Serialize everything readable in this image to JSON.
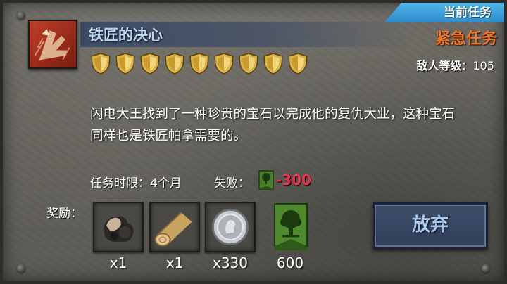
{
  "tab": {
    "label": "当前任务"
  },
  "quest": {
    "title": "铁匠的决心",
    "type_label": "紧急任务",
    "enemy_level_label": "敌人等级：",
    "enemy_level_value": "105",
    "difficulty_shields": 9,
    "description_line1": "闪电大王找到了一种珍贵的宝石以完成他的复仇大业，这种宝石",
    "description_line2": "同样也是铁匠帕拿需要的。",
    "time_limit": "任务时限：4个月",
    "fail_label": "失败：",
    "fail_value": "-300"
  },
  "rewards": {
    "label": "奖励：",
    "items": [
      {
        "icon": "ore-icon",
        "count": "x1"
      },
      {
        "icon": "wood-log-icon",
        "count": "x1"
      },
      {
        "icon": "silver-coin-icon",
        "count": "x330"
      },
      {
        "icon": "tree-banner-icon",
        "count": "600"
      }
    ]
  },
  "actions": {
    "abandon_label": "放弃"
  },
  "colors": {
    "urgent": "#f0762c",
    "title": "#bcd6f2",
    "fail": "#e6334b",
    "tab": "#3aa3dc"
  }
}
